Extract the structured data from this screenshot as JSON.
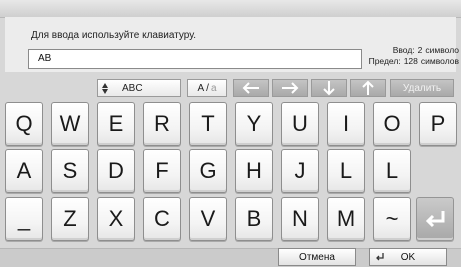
{
  "header": {
    "instruction": "Для ввода используйте клавиатуру.",
    "input_value": "AB"
  },
  "counter": {
    "input_label": "Ввод:",
    "input_count": "2",
    "input_unit": "символо",
    "limit_label": "Предел:",
    "limit_count": "128",
    "limit_unit": "символов"
  },
  "controls": {
    "charset_label": "ABC",
    "case_label_upper": "A",
    "case_sep": "/",
    "case_label_lower": "a",
    "delete_label": "Удалить",
    "icons": [
      "up-down-arrows-icon",
      "arrow-left-icon",
      "arrow-right-icon",
      "arrow-down-icon",
      "arrow-up-icon"
    ]
  },
  "keyboard": {
    "row1": [
      "Q",
      "W",
      "E",
      "R",
      "T",
      "Y",
      "U",
      "I",
      "O",
      "P"
    ],
    "row2": [
      "A",
      "S",
      "D",
      "F",
      "G",
      "H",
      "J",
      "L",
      "L"
    ],
    "row3": [
      "_",
      "Z",
      "X",
      "C",
      "V",
      "B",
      "N",
      "M",
      "~"
    ]
  },
  "footer": {
    "cancel_label": "Отмена",
    "ok_label": "OK"
  },
  "colors": {
    "background": "#d7d7d7",
    "key_face": "#ffffff",
    "enter_key": "#a8a8a8"
  }
}
